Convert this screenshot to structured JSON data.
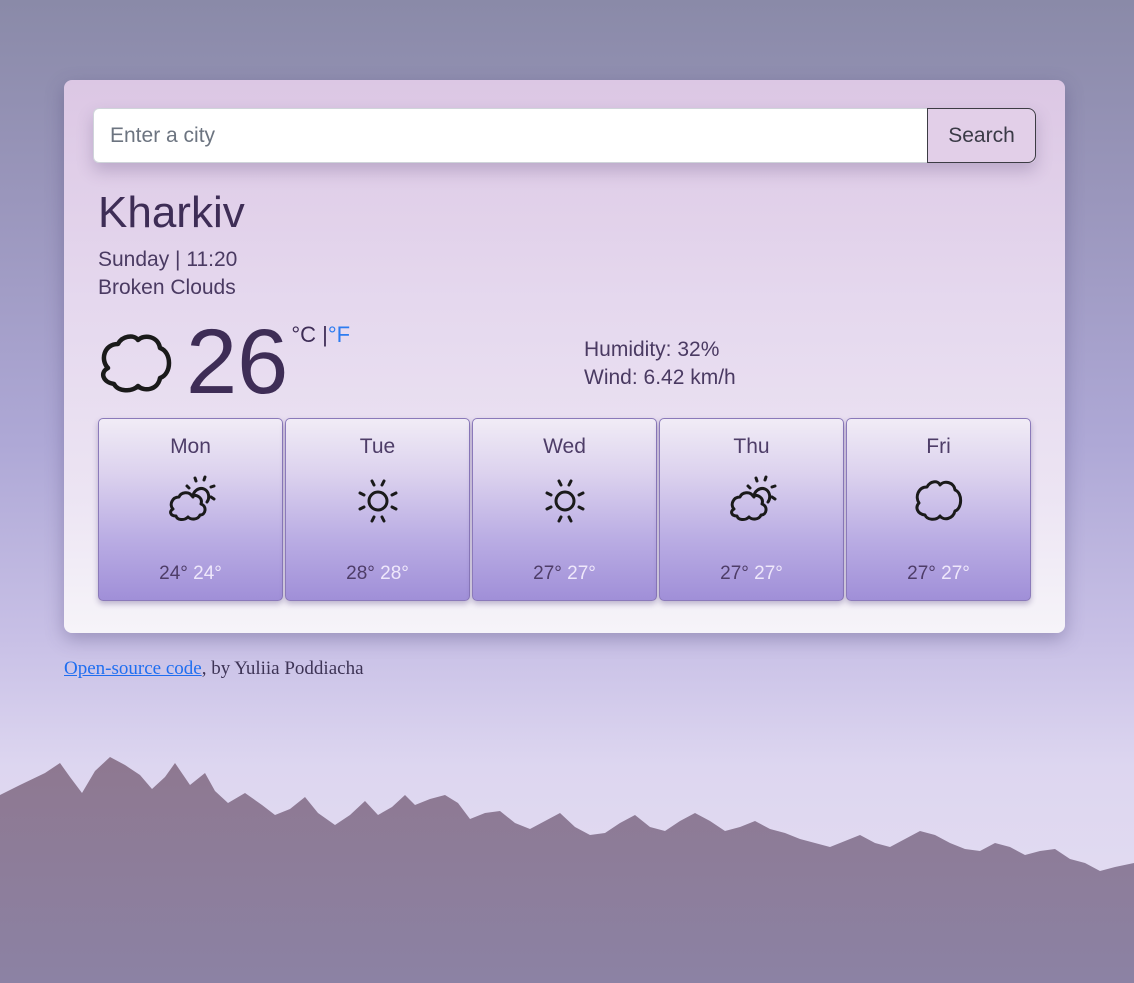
{
  "search": {
    "placeholder": "Enter a city",
    "value": "",
    "button_label": "Search"
  },
  "current": {
    "city": "Kharkiv",
    "datetime": "Sunday | 11:20",
    "description": "Broken Clouds",
    "icon": "cloud-icon",
    "temperature": "26",
    "unit_celsius": "°C",
    "unit_separator": " |",
    "unit_fahrenheit": "°F",
    "humidity": "Humidity: 32%",
    "wind": "Wind: 6.42 km/h"
  },
  "forecast": [
    {
      "day": "Mon",
      "icon": "partly-cloudy-icon",
      "max": "24°",
      "min": "24°"
    },
    {
      "day": "Tue",
      "icon": "sun-icon",
      "max": "28°",
      "min": "28°"
    },
    {
      "day": "Wed",
      "icon": "sun-icon",
      "max": "27°",
      "min": "27°"
    },
    {
      "day": "Thu",
      "icon": "partly-cloudy-icon",
      "max": "27°",
      "min": "27°"
    },
    {
      "day": "Fri",
      "icon": "cloud-icon",
      "max": "27°",
      "min": "27°"
    }
  ],
  "footer": {
    "link_text": "Open-source code",
    "suffix": ", by Yuliia Poddiacha"
  },
  "colors": {
    "accent_link": "#1f6ef0",
    "text_primary": "#3e2d56",
    "forecast_bottom": "#a08fd8"
  }
}
